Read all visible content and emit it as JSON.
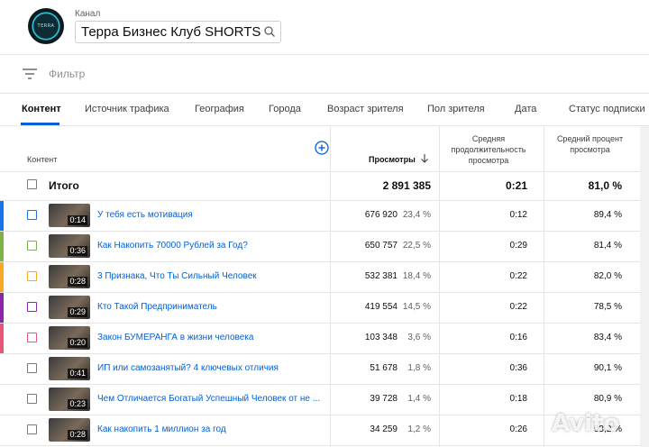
{
  "header": {
    "channel_label": "Канал",
    "channel_name": "Терра Бизнес Клуб SHORTS",
    "logo_text": "TERRA"
  },
  "filter": {
    "label": "Фильтр"
  },
  "tabs": [
    {
      "label": "Контент",
      "active": true
    },
    {
      "label": "Источник трафика"
    },
    {
      "label": "География"
    },
    {
      "label": "Города"
    },
    {
      "label": "Возраст зрителя"
    },
    {
      "label": "Пол зрителя"
    },
    {
      "label": "Дата"
    },
    {
      "label": "Статус подписки"
    }
  ],
  "columns": {
    "content": "Контент",
    "views": "Просмотры",
    "avg_duration": "Средняя продолжительность просмотра",
    "avg_percent": "Средний процент просмотра"
  },
  "total": {
    "label": "Итого",
    "views": "2 891 385",
    "avg_duration": "0:21",
    "avg_percent": "81,0 %"
  },
  "rows": [
    {
      "color": "#1a73e8",
      "duration": "0:14",
      "title": "У тебя есть мотивация",
      "views": "676 920",
      "share": "23,4 %",
      "avg_duration": "0:12",
      "avg_percent": "89,4 %"
    },
    {
      "color": "#7cb342",
      "duration": "0:36",
      "title": "Как Накопить 70000 Рублей за Год?",
      "views": "650 757",
      "share": "22,5 %",
      "avg_duration": "0:29",
      "avg_percent": "81,4 %"
    },
    {
      "color": "#f9a825",
      "duration": "0:28",
      "title": "3 Признака, Что Ты Сильный Человек",
      "views": "532 381",
      "share": "18,4 %",
      "avg_duration": "0:22",
      "avg_percent": "82,0 %"
    },
    {
      "color": "#8e24aa",
      "duration": "0:29",
      "title": "Кто Такой Предприниматель",
      "views": "419 554",
      "share": "14,5 %",
      "avg_duration": "0:22",
      "avg_percent": "78,5 %"
    },
    {
      "color": "#e8577a",
      "duration": "0:20",
      "title": "Закон БУМЕРАНГА в жизни человека",
      "views": "103 348",
      "share": "3,6 %",
      "avg_duration": "0:16",
      "avg_percent": "83,4 %"
    },
    {
      "color": "",
      "duration": "0:41",
      "title": "ИП или самозанятый? 4 ключевых отличия",
      "views": "51 678",
      "share": "1,8 %",
      "avg_duration": "0:36",
      "avg_percent": "90,1 %"
    },
    {
      "color": "",
      "duration": "0:23",
      "title": "Чем Отличается Богатый Успешный Человек от не ...",
      "views": "39 728",
      "share": "1,4 %",
      "avg_duration": "0:18",
      "avg_percent": "80,9 %"
    },
    {
      "color": "",
      "duration": "0:28",
      "title": "Как накопить 1 миллион за год",
      "views": "34 259",
      "share": "1,2 %",
      "avg_duration": "0:26",
      "avg_percent": "93,2 %"
    }
  ],
  "watermark": "Avito"
}
